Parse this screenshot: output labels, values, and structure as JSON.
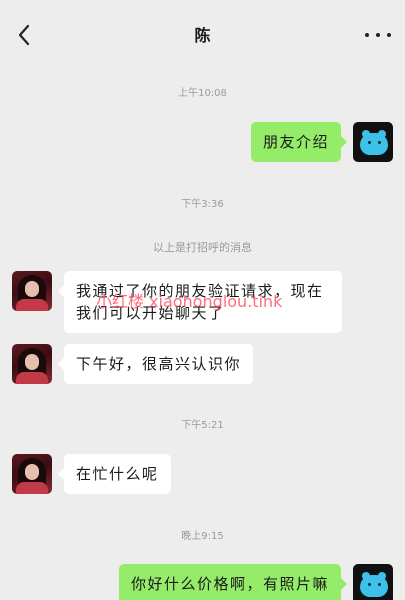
{
  "header": {
    "title": "陈",
    "back_icon": "chevron-left-icon",
    "more_icon": "more-dots-icon"
  },
  "timestamps": [
    "上午10:08",
    "下午3:36",
    "下午5:21",
    "晚上9:15"
  ],
  "system_notice": "以上是打招呼的消息",
  "messages": [
    {
      "direction": "out",
      "text": "朋友介绍"
    },
    {
      "direction": "in",
      "line1": "我通过了你的朋友验证请求，现在",
      "line2": "我们可以开始聊天了"
    },
    {
      "direction": "in",
      "text": "下午好，很高兴认识你"
    },
    {
      "direction": "in",
      "text": "在忙什么呢"
    },
    {
      "direction": "out",
      "text": "你好什么价格啊，有照片嘛"
    }
  ],
  "watermark": "小红楼 xiaohonglou.tink",
  "colors": {
    "background": "#ededed",
    "outgoing_bubble": "#95ec69",
    "incoming_bubble": "#ffffff",
    "watermark": "#ff465a"
  }
}
